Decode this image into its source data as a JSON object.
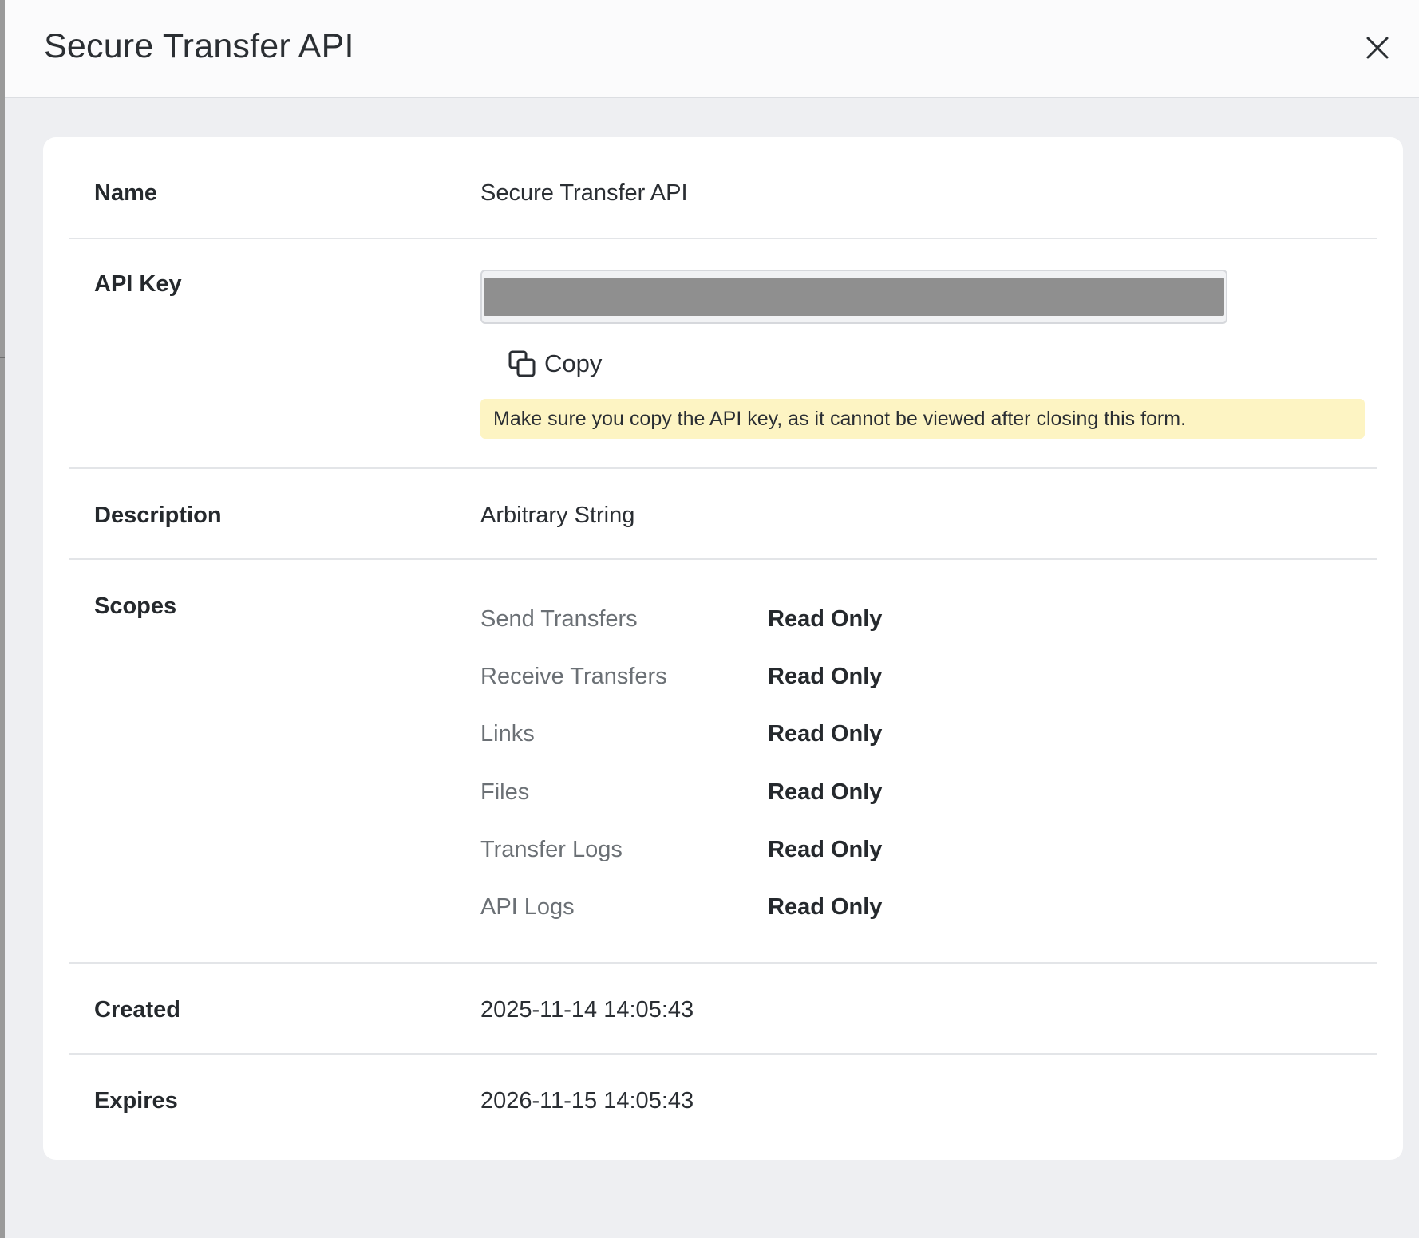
{
  "header": {
    "title": "Secure Transfer API"
  },
  "details": {
    "name_label": "Name",
    "name_value": "Secure Transfer API",
    "api_key_label": "API Key",
    "copy_label": "Copy",
    "copy_warning": "Make sure you copy the API key, as it cannot be viewed after closing this form.",
    "description_label": "Description",
    "description_value": "Arbitrary String",
    "scopes_label": "Scopes",
    "scopes": [
      {
        "name": "Send Transfers",
        "level": "Read Only"
      },
      {
        "name": "Receive Transfers",
        "level": "Read Only"
      },
      {
        "name": "Links",
        "level": "Read Only"
      },
      {
        "name": "Files",
        "level": "Read Only"
      },
      {
        "name": "Transfer Logs",
        "level": "Read Only"
      },
      {
        "name": "API Logs",
        "level": "Read Only"
      }
    ],
    "created_label": "Created",
    "created_value": "2025-11-14 14:05:43",
    "expires_label": "Expires",
    "expires_value": "2026-11-15 14:05:43"
  },
  "icons": {
    "close": "close-icon",
    "copy": "copy-icon"
  },
  "colors": {
    "warning_bg": "#fdf4c3",
    "masked_key": "#8f8f8f"
  }
}
